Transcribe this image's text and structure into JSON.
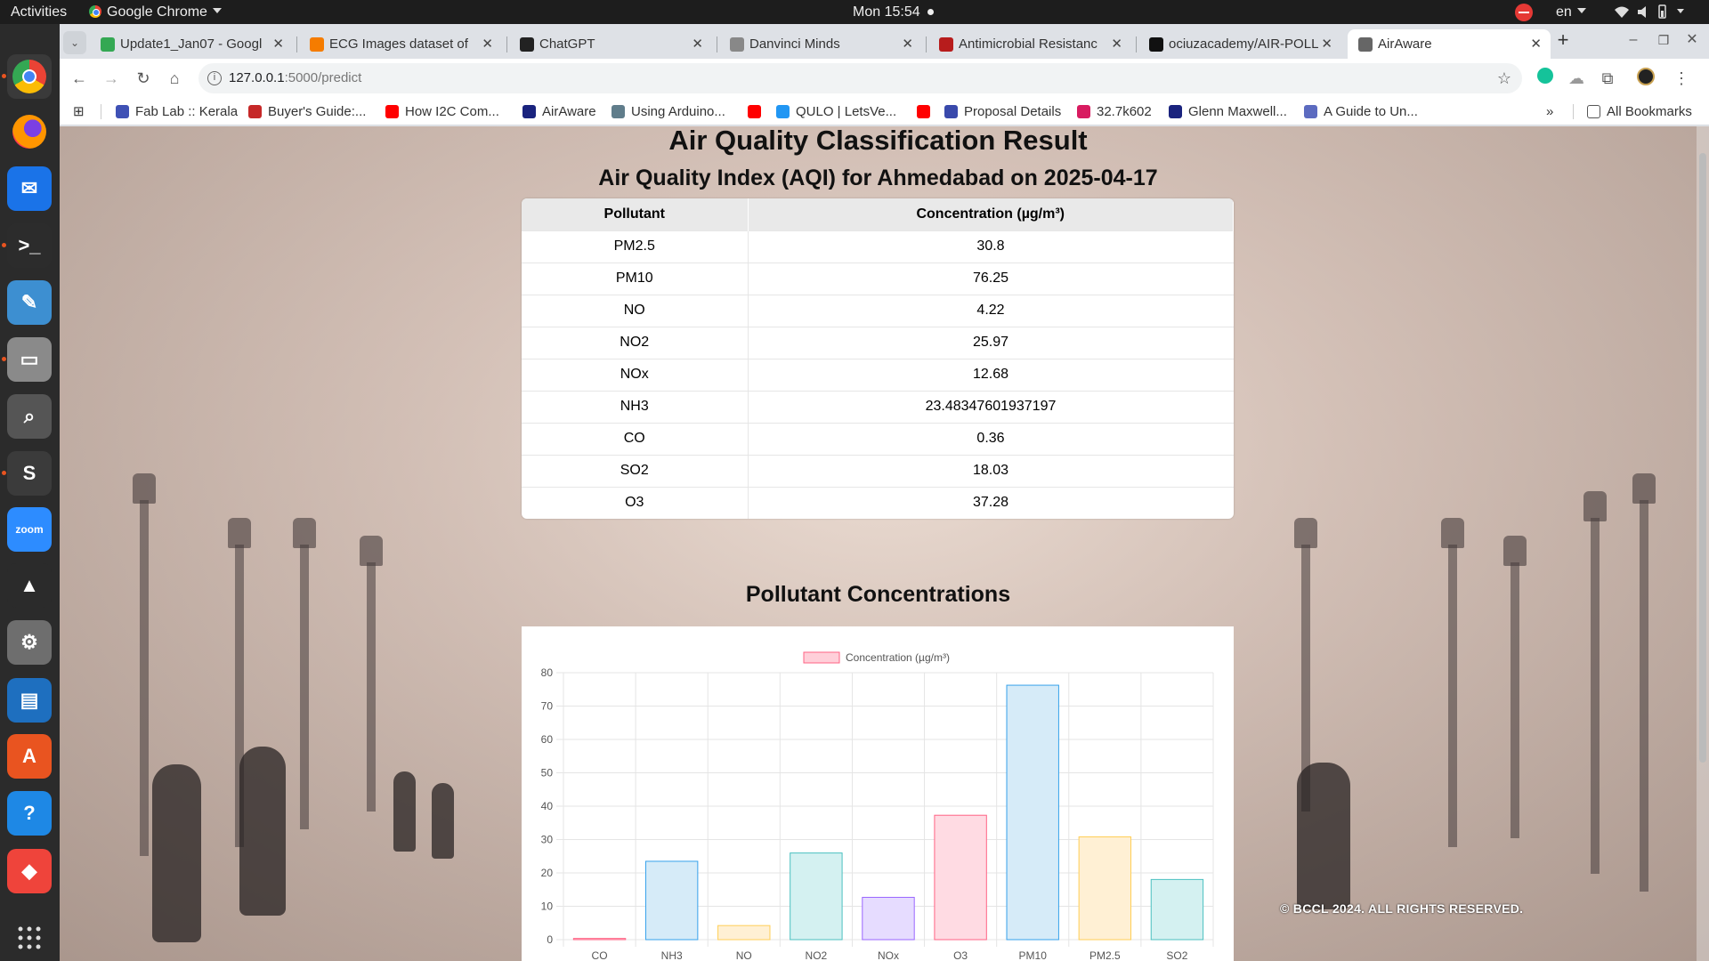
{
  "topbar": {
    "activities": "Activities",
    "app_name": "Google Chrome",
    "clock": "Mon 15:54",
    "lang": "en"
  },
  "browser": {
    "tabs": [
      {
        "title": "Update1_Jan07 - Googl",
        "icon_color": "#34a853"
      },
      {
        "title": "ECG Images dataset of",
        "icon_color": "#f57c00"
      },
      {
        "title": "ChatGPT",
        "icon_color": "#222222"
      },
      {
        "title": "Danvinci Minds",
        "icon_color": "#888888"
      },
      {
        "title": "Antimicrobial Resistanc",
        "icon_color": "#b71c1c"
      },
      {
        "title": "ociuzacademy/AIR-POLL",
        "icon_color": "#111111"
      },
      {
        "title": "AirAware",
        "icon_color": "#666666"
      }
    ],
    "new_tab": "+",
    "url_host": "127.0.0.1",
    "url_path": ":5000/predict",
    "bookmarks": [
      {
        "label": "Fab Lab :: Kerala",
        "icon_color": "#3f51b5"
      },
      {
        "label": "Buyer's Guide:...",
        "icon_color": "#c62828"
      },
      {
        "label": "How I2C Com...",
        "icon_color": "#ff0000"
      },
      {
        "label": "AirAware",
        "icon_color": "#1a237e"
      },
      {
        "label": "Using Arduino...",
        "icon_color": "#607d8b"
      },
      {
        "label": "",
        "icon_color": "#ff0000"
      },
      {
        "label": "QULO | LetsVe...",
        "icon_color": "#2196f3"
      },
      {
        "label": "",
        "icon_color": "#ff0000"
      },
      {
        "label": "Proposal Details",
        "icon_color": "#3949ab"
      },
      {
        "label": "32.7k602",
        "icon_color": "#d81b60"
      },
      {
        "label": "Glenn Maxwell...",
        "icon_color": "#1a237e"
      },
      {
        "label": "A Guide to Un...",
        "icon_color": "#5c6bc0"
      }
    ],
    "all_bookmarks": "All Bookmarks"
  },
  "page": {
    "title": "Air Quality Classification Result",
    "subtitle": "Air Quality Index (AQI) for Ahmedabad on 2025-04-17",
    "table": {
      "headers": [
        "Pollutant",
        "Concentration (µg/m³)"
      ],
      "rows": [
        [
          "PM2.5",
          "30.8"
        ],
        [
          "PM10",
          "76.25"
        ],
        [
          "NO",
          "4.22"
        ],
        [
          "NO2",
          "25.97"
        ],
        [
          "NOx",
          "12.68"
        ],
        [
          "NH3",
          "23.48347601937197"
        ],
        [
          "CO",
          "0.36"
        ],
        [
          "SO2",
          "18.03"
        ],
        [
          "O3",
          "37.28"
        ]
      ]
    },
    "chart_heading": "Pollutant Concentrations",
    "watermark": "© BCCL 2024. ALL RIGHTS RESERVED."
  },
  "chart_data": {
    "type": "bar",
    "categories": [
      "CO",
      "NH3",
      "NO",
      "NO2",
      "NOx",
      "O3",
      "PM10",
      "PM2.5",
      "SO2"
    ],
    "series": [
      {
        "name": "Concentration (µg/m³)",
        "values": [
          0.36,
          23.48347601937197,
          4.22,
          25.97,
          12.68,
          37.28,
          76.25,
          30.8,
          18.03
        ]
      }
    ],
    "ylim": [
      0,
      80
    ],
    "yticks": [
      0,
      10,
      20,
      30,
      40,
      50,
      60,
      70,
      80
    ],
    "grid": true,
    "legend": "top-center",
    "colors": [
      {
        "fill": "#ffcfd9",
        "stroke": "#ff6384"
      },
      {
        "fill": "#d6ebf8",
        "stroke": "#36a2eb"
      },
      {
        "fill": "#fff0d4",
        "stroke": "#ffce56"
      },
      {
        "fill": "#d4f1f1",
        "stroke": "#4bc0c0"
      },
      {
        "fill": "#e6dcff",
        "stroke": "#9966ff"
      },
      {
        "fill": "#ffdbe3",
        "stroke": "#ff6384"
      },
      {
        "fill": "#d6ebf8",
        "stroke": "#36a2eb"
      },
      {
        "fill": "#fff0d4",
        "stroke": "#ffce56"
      },
      {
        "fill": "#d4f1f1",
        "stroke": "#4bc0c0"
      }
    ]
  },
  "dock": [
    {
      "name": "chrome",
      "color": "#4285f4",
      "glyph": "",
      "running": true
    },
    {
      "name": "firefox",
      "color": "#ff7139",
      "glyph": "",
      "running": false
    },
    {
      "name": "thunderbird",
      "color": "#1a73e8",
      "glyph": "✉",
      "running": false
    },
    {
      "name": "terminal",
      "color": "#2c2c2c",
      "glyph": ">_",
      "running": true
    },
    {
      "name": "text-editor",
      "color": "#3d8fd1",
      "glyph": "✎",
      "running": false
    },
    {
      "name": "files",
      "color": "#8a8a8a",
      "glyph": "▭",
      "running": true
    },
    {
      "name": "image-viewer",
      "color": "#555555",
      "glyph": "⌕",
      "running": false
    },
    {
      "name": "sublime",
      "color": "#3b3b3b",
      "glyph": "S",
      "running": true
    },
    {
      "name": "zoom",
      "color": "#2d8cff",
      "glyph": "zoom",
      "running": false
    },
    {
      "name": "vlc",
      "color": "#2b2b2b",
      "glyph": "▲",
      "running": false
    },
    {
      "name": "settings",
      "color": "#6e6e6e",
      "glyph": "⚙",
      "running": false
    },
    {
      "name": "writer",
      "color": "#1e6fbf",
      "glyph": "▤",
      "running": false
    },
    {
      "name": "app-center",
      "color": "#e95420",
      "glyph": "A",
      "running": false
    },
    {
      "name": "help",
      "color": "#1e88e5",
      "glyph": "?",
      "running": false
    },
    {
      "name": "anydesk",
      "color": "#ef443b",
      "glyph": "◆",
      "running": false
    }
  ]
}
